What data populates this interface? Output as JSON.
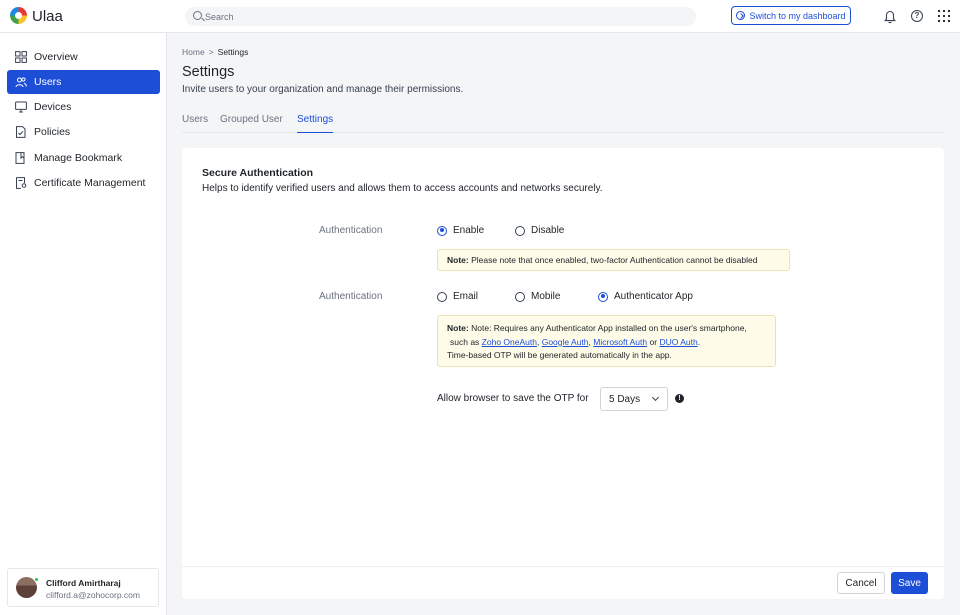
{
  "app": {
    "name": "Ulaa"
  },
  "search": {
    "placeholder": "Search"
  },
  "header": {
    "switch_label": "Switch to my dashboard"
  },
  "sidebar": {
    "items": [
      {
        "label": "Overview",
        "icon": "grid-icon"
      },
      {
        "label": "Users",
        "icon": "users-icon",
        "active": true
      },
      {
        "label": "Devices",
        "icon": "monitor-icon"
      },
      {
        "label": "Policies",
        "icon": "document-check-icon"
      },
      {
        "label": "Manage Bookmark",
        "icon": "bookmark-icon"
      },
      {
        "label": "Certificate Management",
        "icon": "certificate-icon"
      }
    ],
    "user": {
      "name": "Clifford Amirtharaj",
      "email": "clifford.a@zohocorp.com"
    }
  },
  "breadcrumb": {
    "home": "Home",
    "separator": ">",
    "current": "Settings"
  },
  "page": {
    "title": "Settings",
    "subtitle": "Invite users to your organization and manage their permissions."
  },
  "tabs": [
    {
      "label": "Users"
    },
    {
      "label": "Grouped User"
    },
    {
      "label": "Settings",
      "active": true
    }
  ],
  "section": {
    "title": "Secure Authentication",
    "description": "Helps to identify verified users and allows them to access accounts and networks securely."
  },
  "auth_toggle": {
    "label": "Authentication",
    "options": [
      "Enable",
      "Disable"
    ],
    "selected": "Enable",
    "note_prefix": "Note:",
    "note_text": "Please note that once enabled, two-factor Authentication cannot be disabled"
  },
  "auth_method": {
    "label": "Authentication",
    "options": [
      "Email",
      "Mobile",
      "Authenticator App"
    ],
    "selected": "Authenticator App",
    "note_prefix": "Note:",
    "note_line1": "Note: Requires any Authenticator App installed on the user's smartphone,",
    "note_line2_prefix": "such as",
    "apps": [
      "Zoho OneAuth",
      "Google Auth",
      "Microsoft Auth",
      "DUO Auth"
    ],
    "sep_comma": ",",
    "sep_or": "or",
    "end_period": ".",
    "note_line3": "Time-based OTP will be generated automatically in the app."
  },
  "otp": {
    "label": "Allow browser to save the OTP for",
    "value": "5 Days"
  },
  "footer": {
    "cancel_label": "Cancel",
    "save_label": "Save"
  },
  "colors": {
    "accent": "#1d4ed8",
    "note_bg": "#fefce8"
  }
}
